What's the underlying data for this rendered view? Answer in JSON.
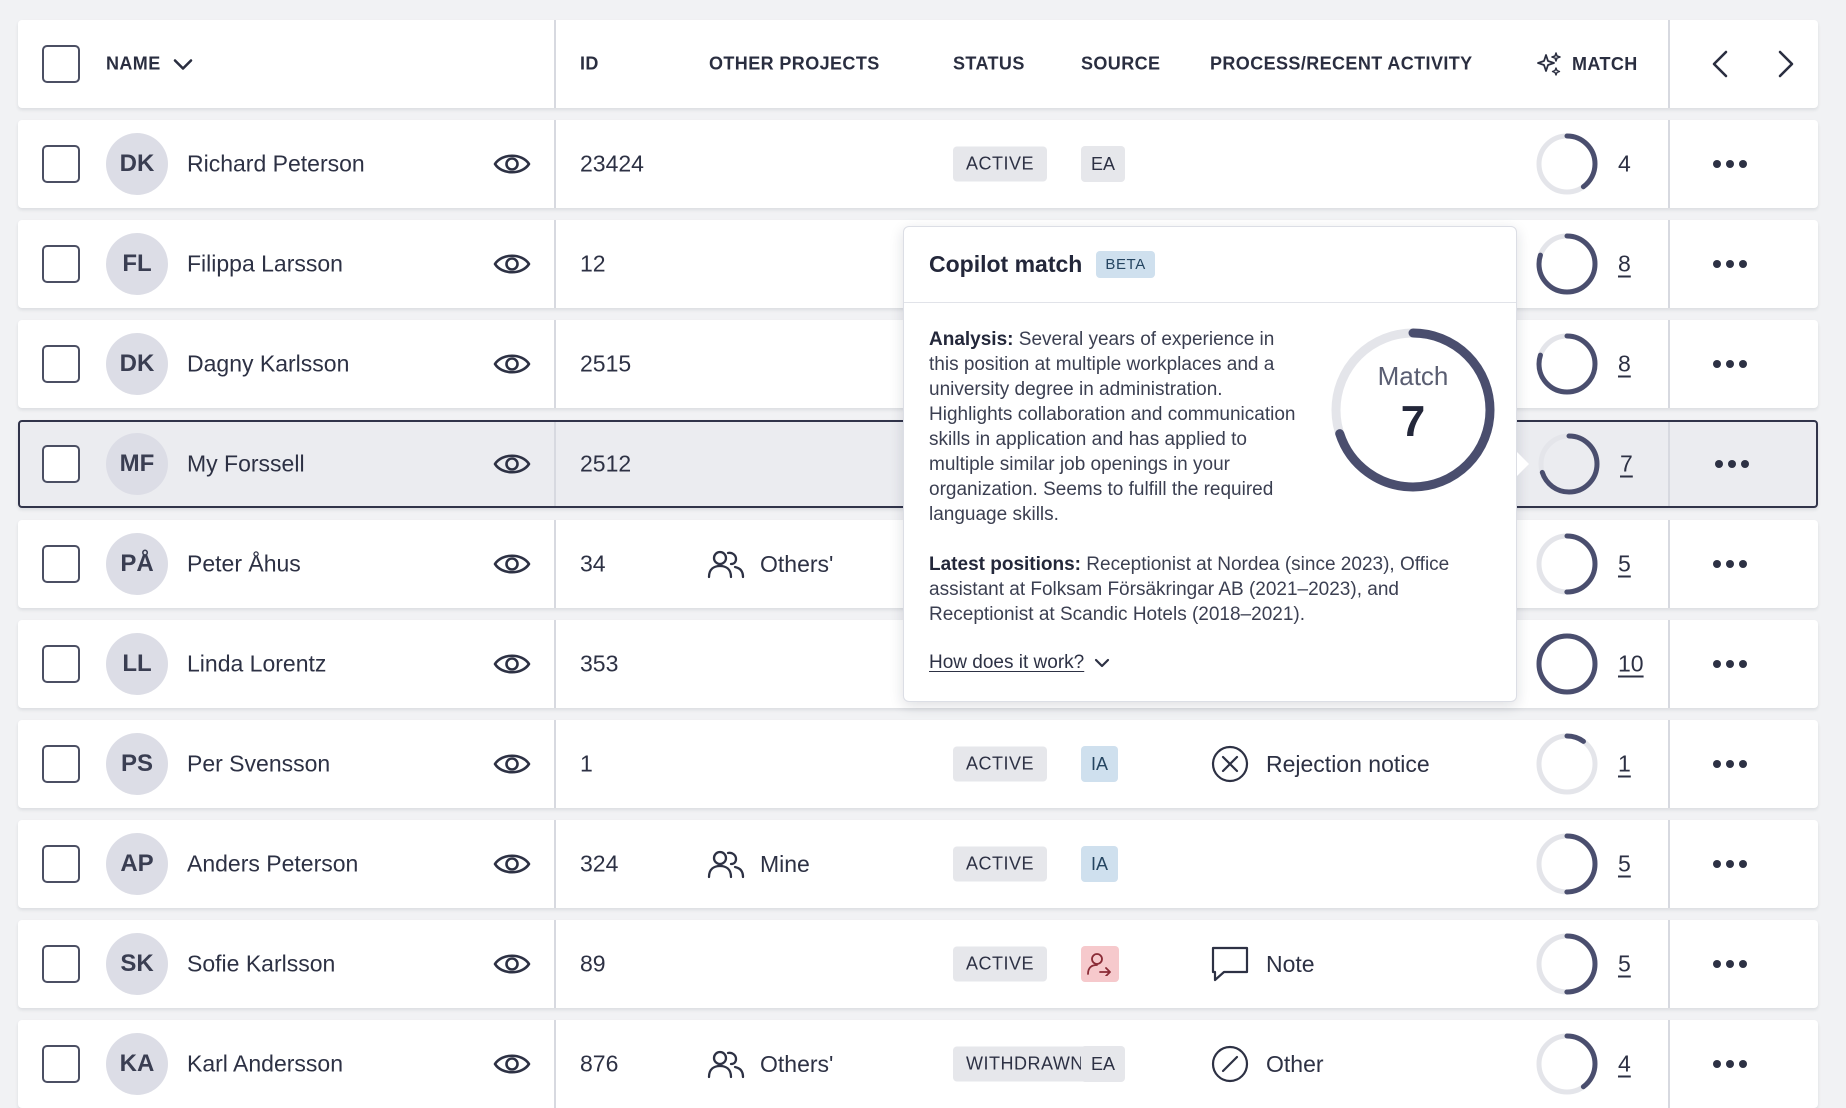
{
  "header": {
    "name": "NAME",
    "id": "ID",
    "other_projects": "OTHER PROJECTS",
    "status": "STATUS",
    "source": "SOURCE",
    "activity": "PROCESS/RECENT ACTIVITY",
    "match": "MATCH"
  },
  "rows": [
    {
      "initials": "DK",
      "name": "Richard Peterson",
      "id": "23424",
      "status": "ACTIVE",
      "source": "EA",
      "match": "4"
    },
    {
      "initials": "FL",
      "name": "Filippa Larsson",
      "id": "12",
      "match": "8"
    },
    {
      "initials": "DK",
      "name": "Dagny Karlsson",
      "id": "2515",
      "match": "8"
    },
    {
      "initials": "MF",
      "name": "My Forssell",
      "id": "2512",
      "match": "7"
    },
    {
      "initials": "PÅ",
      "name": "Peter Åhus",
      "id": "34",
      "project": "Others'",
      "match": "5"
    },
    {
      "initials": "LL",
      "name": "Linda Lorentz",
      "id": "353",
      "match": "10"
    },
    {
      "initials": "PS",
      "name": "Per Svensson",
      "id": "1",
      "status": "ACTIVE",
      "source": "IA",
      "activity": "Rejection notice",
      "match": "1"
    },
    {
      "initials": "AP",
      "name": "Anders Peterson",
      "id": "324",
      "project": "Mine",
      "status": "ACTIVE",
      "source": "IA",
      "match": "5"
    },
    {
      "initials": "SK",
      "name": "Sofie Karlsson",
      "id": "89",
      "status": "ACTIVE",
      "activity": "Note",
      "match": "5"
    },
    {
      "initials": "KA",
      "name": "Karl Andersson",
      "id": "876",
      "project": "Others'",
      "status": "WITHDRAWN",
      "source": "EA",
      "activity": "Other",
      "match": "4"
    }
  ],
  "popover": {
    "title": "Copilot match",
    "badge": "BETA",
    "analysis_label": "Analysis:",
    "analysis_text": "Several years of experience in this position at multiple workplaces and a university degree in administration. Highlights collaboration and communication skills in application and has applied to multiple similar job openings in your organization. Seems to fulfill the required language skills.",
    "latest_label": "Latest positions:",
    "latest_text": "Receptionist at Nordea (since 2023), Office assistant at Folksam Försäkringar AB (2021–2023), and Receptionist at Scandic Hotels (2018–2021).",
    "ring_label": "Match",
    "ring_value": "7",
    "link": "How does it work?"
  },
  "colors": {
    "ring_fill": "#4a4e6e",
    "ring_track": "#e4e5ea",
    "ia_badge": "#cfe0ee",
    "referral_badge": "#f6c9cc"
  }
}
